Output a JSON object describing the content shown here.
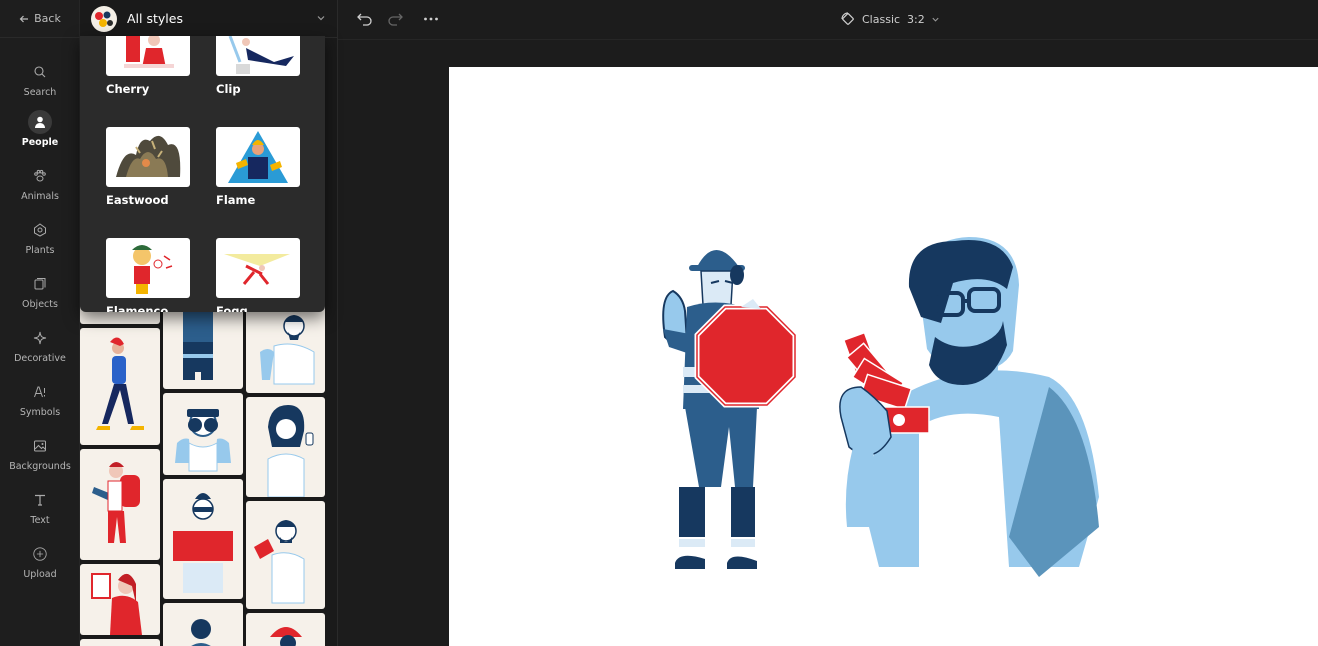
{
  "rail": {
    "back_label": "Back",
    "items": [
      {
        "label": "Search",
        "icon": "search-icon"
      },
      {
        "label": "People",
        "icon": "person-icon",
        "active": true
      },
      {
        "label": "Animals",
        "icon": "paw-icon"
      },
      {
        "label": "Plants",
        "icon": "plant-icon"
      },
      {
        "label": "Objects",
        "icon": "objects-icon"
      },
      {
        "label": "Decorative",
        "icon": "sparkle-icon"
      },
      {
        "label": "Symbols",
        "icon": "symbols-icon"
      },
      {
        "label": "Backgrounds",
        "icon": "image-icon"
      },
      {
        "label": "Text",
        "icon": "text-icon"
      },
      {
        "label": "Upload",
        "icon": "upload-icon"
      }
    ]
  },
  "panel": {
    "style_select_label": "All styles"
  },
  "dropdown": {
    "styles": [
      {
        "name": "Cherry"
      },
      {
        "name": "Clip"
      },
      {
        "name": "Eastwood"
      },
      {
        "name": "Flame"
      },
      {
        "name": "Flamenco"
      },
      {
        "name": "Fogg"
      }
    ]
  },
  "topbar": {
    "ratio_label": "Classic  3:2"
  },
  "colors": {
    "navy": "#16385f",
    "blue": "#2c5e8c",
    "light_blue": "#97c9ec",
    "red": "#e0262c",
    "cream": "#f6f1ea"
  }
}
